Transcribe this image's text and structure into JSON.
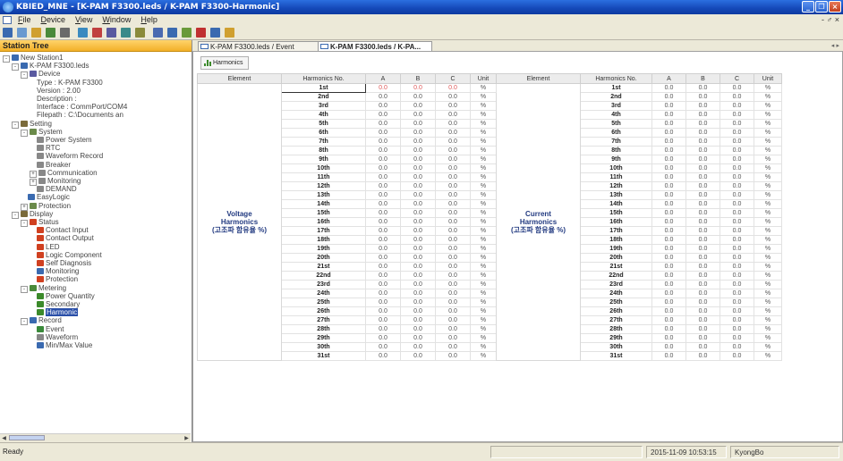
{
  "window": {
    "title": "KBIED_MNE - [K-PAM F3300.leds / K-PAM F3300-Harmonic]"
  },
  "menu": {
    "items": [
      "File",
      "Device",
      "View",
      "Window",
      "Help"
    ],
    "mdi_controls": "- ♂ ×"
  },
  "sidebar": {
    "title": "Station Tree",
    "tree": [
      {
        "label": "New Station1",
        "depth": 0,
        "exp": "-",
        "icon": "#3a6ab0"
      },
      {
        "label": "K-PAM F3300.leds",
        "depth": 1,
        "exp": "-",
        "icon": "#3a6ab0"
      },
      {
        "label": "Device",
        "depth": 2,
        "exp": "-",
        "icon": "#5a5aa0"
      },
      {
        "label": "Type : K-PAM F3300",
        "depth": 3,
        "exp": "",
        "icon": ""
      },
      {
        "label": "Version : 2.00",
        "depth": 3,
        "exp": "",
        "icon": ""
      },
      {
        "label": "Description :",
        "depth": 3,
        "exp": "",
        "icon": ""
      },
      {
        "label": "Interface : CommPort/COM4",
        "depth": 3,
        "exp": "",
        "icon": ""
      },
      {
        "label": "Filepath : C:\\Documents an",
        "depth": 3,
        "exp": "",
        "icon": ""
      },
      {
        "label": "Setting",
        "depth": 1,
        "exp": "-",
        "icon": "#7a6a3a"
      },
      {
        "label": "System",
        "depth": 2,
        "exp": "-",
        "icon": "#6a8a4a"
      },
      {
        "label": "Power System",
        "depth": 3,
        "exp": "",
        "icon": "#888"
      },
      {
        "label": "RTC",
        "depth": 3,
        "exp": "",
        "icon": "#888"
      },
      {
        "label": "Waveform Record",
        "depth": 3,
        "exp": "",
        "icon": "#888"
      },
      {
        "label": "Breaker",
        "depth": 3,
        "exp": "",
        "icon": "#888"
      },
      {
        "label": "Communication",
        "depth": 3,
        "exp": "+",
        "icon": "#888"
      },
      {
        "label": "Monitoring",
        "depth": 3,
        "exp": "+",
        "icon": "#888"
      },
      {
        "label": "DEMAND",
        "depth": 3,
        "exp": "",
        "icon": "#888"
      },
      {
        "label": "EasyLogic",
        "depth": 2,
        "exp": "",
        "icon": "#3a6ab0"
      },
      {
        "label": "Protection",
        "depth": 2,
        "exp": "+",
        "icon": "#6a8a4a"
      },
      {
        "label": "Display",
        "depth": 1,
        "exp": "-",
        "icon": "#7a6a3a"
      },
      {
        "label": "Status",
        "depth": 2,
        "exp": "-",
        "icon": "#d04020"
      },
      {
        "label": "Contact Input",
        "depth": 3,
        "exp": "",
        "icon": "#d04020"
      },
      {
        "label": "Contact Output",
        "depth": 3,
        "exp": "",
        "icon": "#d04020"
      },
      {
        "label": "LED",
        "depth": 3,
        "exp": "",
        "icon": "#d04020"
      },
      {
        "label": "Logic Component",
        "depth": 3,
        "exp": "",
        "icon": "#d04020"
      },
      {
        "label": "Self Diagnosis",
        "depth": 3,
        "exp": "",
        "icon": "#d04020"
      },
      {
        "label": "Monitoring",
        "depth": 3,
        "exp": "",
        "icon": "#3a6ab0"
      },
      {
        "label": "Protection",
        "depth": 3,
        "exp": "",
        "icon": "#d04020"
      },
      {
        "label": "Metering",
        "depth": 2,
        "exp": "-",
        "icon": "#4a8a3a"
      },
      {
        "label": "Power Quantity",
        "depth": 3,
        "exp": "",
        "icon": "#3b8a2a"
      },
      {
        "label": "Secondary",
        "depth": 3,
        "exp": "",
        "icon": "#3b8a2a"
      },
      {
        "label": "Harmonic",
        "depth": 3,
        "exp": "",
        "icon": "#3b8a2a",
        "selected": true
      },
      {
        "label": "Record",
        "depth": 2,
        "exp": "-",
        "icon": "#3a6ab0"
      },
      {
        "label": "Event",
        "depth": 3,
        "exp": "",
        "icon": "#3a8a3a"
      },
      {
        "label": "Waveform",
        "depth": 3,
        "exp": "",
        "icon": "#888"
      },
      {
        "label": "Min/Max Value",
        "depth": 3,
        "exp": "",
        "icon": "#3a6ab0"
      }
    ]
  },
  "tabs": [
    {
      "label": "K-PAM F3300.leds / Event",
      "active": false
    },
    {
      "label": "K-PAM F3300.leds / K-PA...",
      "active": true
    }
  ],
  "tab_nav": "◂ ▸",
  "content": {
    "button": "Harmonics",
    "columns": [
      "Element",
      "Harmonics No.",
      "A",
      "B",
      "C",
      "Unit",
      "Element",
      "Harmonics No.",
      "A",
      "B",
      "C",
      "Unit"
    ],
    "voltage_label": [
      "Voltage",
      "Harmonics",
      "(고조파 함유율 %)"
    ],
    "current_label": [
      "Current",
      "Harmonics",
      "(고조파 함유율 %)"
    ],
    "rows": [
      "1st",
      "2nd",
      "3rd",
      "4th",
      "5th",
      "6th",
      "7th",
      "8th",
      "9th",
      "10th",
      "11th",
      "12th",
      "13th",
      "14th",
      "15th",
      "16th",
      "17th",
      "18th",
      "19th",
      "20th",
      "21st",
      "22nd",
      "23rd",
      "24th",
      "25th",
      "26th",
      "27th",
      "28th",
      "29th",
      "30th",
      "31st"
    ],
    "value": "0.0",
    "unit": "%"
  },
  "status": {
    "ready": "Ready",
    "datetime": "2015-11-09 10:53:15",
    "user": "KyongBo"
  }
}
